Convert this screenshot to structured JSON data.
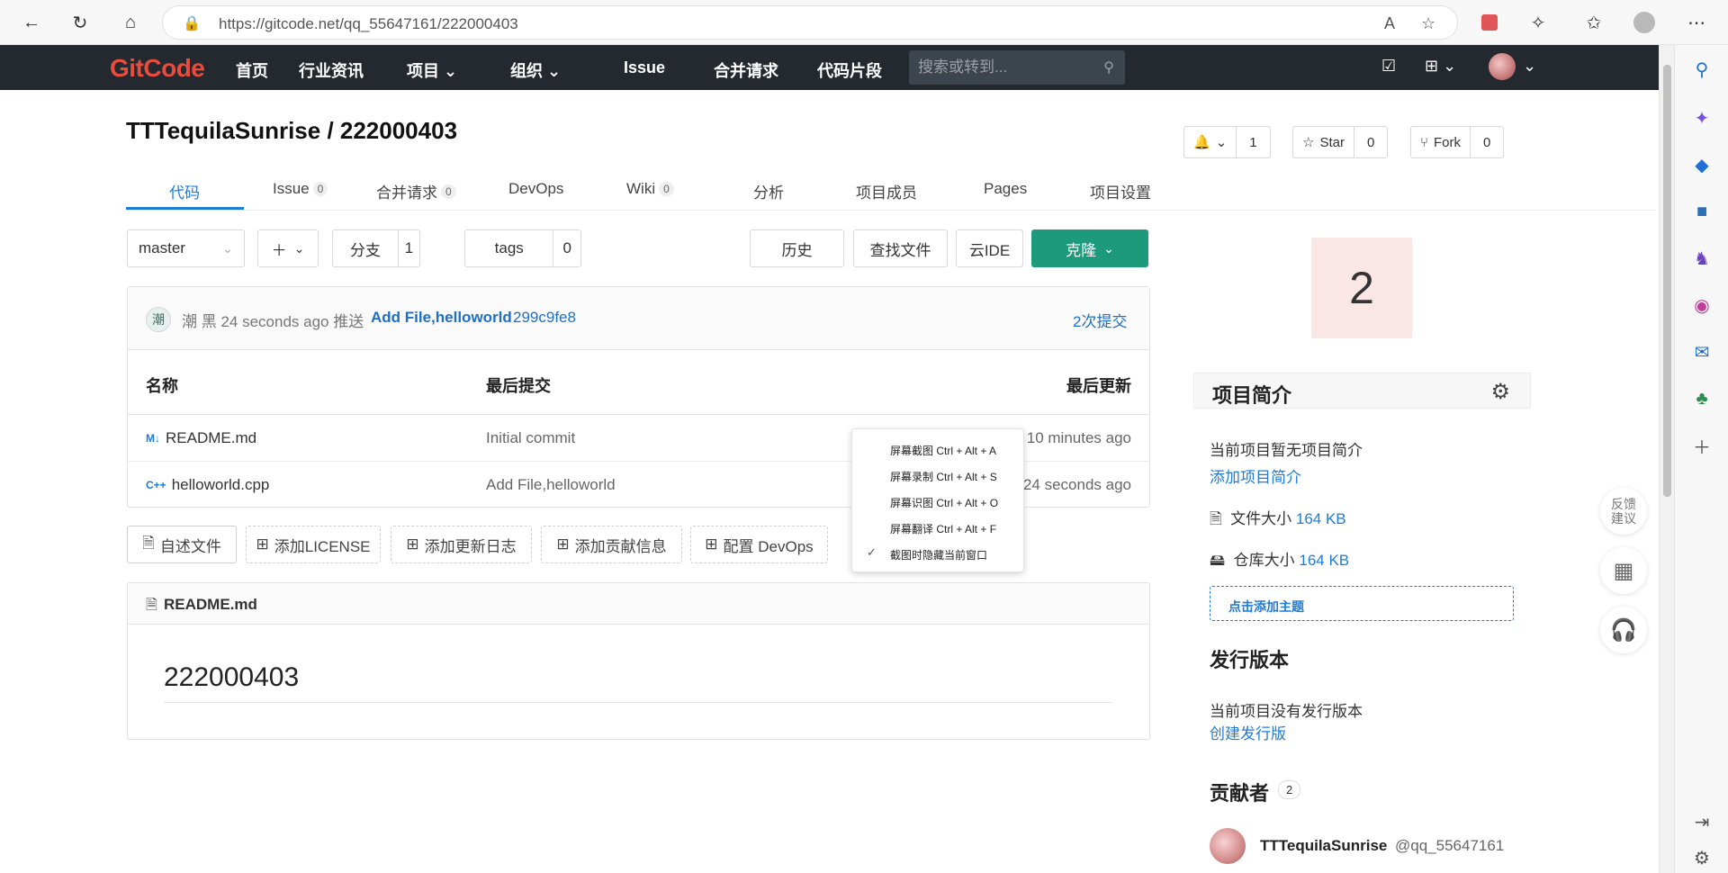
{
  "browser": {
    "url": "https://gitcode.net/qq_55647161/222000403",
    "icons": [
      "back-icon",
      "refresh-icon",
      "home-icon",
      "lock-icon",
      "read-aloud-icon",
      "favorite-add-icon",
      "extension-icon",
      "puzzle-icon",
      "favorites-icon",
      "profile-icon",
      "more-icon"
    ]
  },
  "gc_header": {
    "logo": "GitCode",
    "nav": {
      "home": "首页",
      "news": "行业资讯",
      "projects": "项目",
      "orgs": "组织",
      "issue": "Issue",
      "merge": "合并请求",
      "snippets": "代码片段"
    },
    "search_placeholder": "搜索或转到..."
  },
  "repo": {
    "title": "TTTequilaSunrise / 222000403",
    "watch_count": "1",
    "star_label": "Star",
    "star_count": "0",
    "fork_label": "Fork",
    "fork_count": "0"
  },
  "tabs": {
    "code": "代码",
    "issue": "Issue",
    "issue_badge": "0",
    "merge": "合并请求",
    "merge_badge": "0",
    "devops": "DevOps",
    "wiki": "Wiki",
    "wiki_badge": "0",
    "analysis": "分析",
    "members": "项目成员",
    "pages": "Pages",
    "settings": "项目设置"
  },
  "toolbar": {
    "branch": "master",
    "branches_label": "分支",
    "branches_count": "1",
    "tags_label": "tags",
    "tags_count": "0",
    "history": "历史",
    "find_file": "查找文件",
    "cloud_ide": "云IDE",
    "clone": "克隆"
  },
  "last_commit": {
    "avatar_char": "潮",
    "author_time": "潮 黑 24 seconds ago 推送",
    "message": "Add File,helloworld",
    "sha": "299c9fe8",
    "commits_link": "2次提交"
  },
  "files": {
    "headers": {
      "name": "名称",
      "last_commit": "最后提交",
      "last_update": "最后更新"
    },
    "rows": [
      {
        "icon": "M↓",
        "name": "README.md",
        "commit": "Initial commit",
        "updated": "10 minutes ago"
      },
      {
        "icon": "C++",
        "name": "helloworld.cpp",
        "commit": "Add File,helloworld",
        "updated": "24 seconds ago"
      }
    ]
  },
  "add_buttons": {
    "readme": "自述文件",
    "license": "添加LICENSE",
    "changelog": "添加更新日志",
    "contrib": "添加贡献信息",
    "devops": "配置 DevOps"
  },
  "readme": {
    "file_name": "README.md",
    "heading": "222000403"
  },
  "context_menu": {
    "items": [
      "屏幕截图 Ctrl + Alt + A",
      "屏幕录制 Ctrl + Alt + S",
      "屏幕识图 Ctrl + Alt + O",
      "屏幕翻译 Ctrl + Alt + F",
      "截图时隐藏当前窗口"
    ]
  },
  "sidebar": {
    "avatar_char": "2",
    "intro_title": "项目简介",
    "no_intro": "当前项目暂无项目简介",
    "add_intro": "添加项目简介",
    "file_size_label": "文件大小",
    "file_size": "164 KB",
    "repo_size_label": "仓库大小",
    "repo_size": "164 KB",
    "add_topic": "点击添加主题",
    "release_title": "发行版本",
    "no_release": "当前项目没有发行版本",
    "create_release": "创建发行版",
    "contributors_title": "贡献者",
    "contributors_count": "2",
    "contributor_name": "TTTequilaSunrise",
    "contributor_handle": "@qq_55647161"
  },
  "floating": {
    "feedback": "反馈\n建议"
  },
  "colors": {
    "header_bg": "#24292f",
    "accent": "#1e7bd8",
    "clone": "#1d9a7b"
  }
}
